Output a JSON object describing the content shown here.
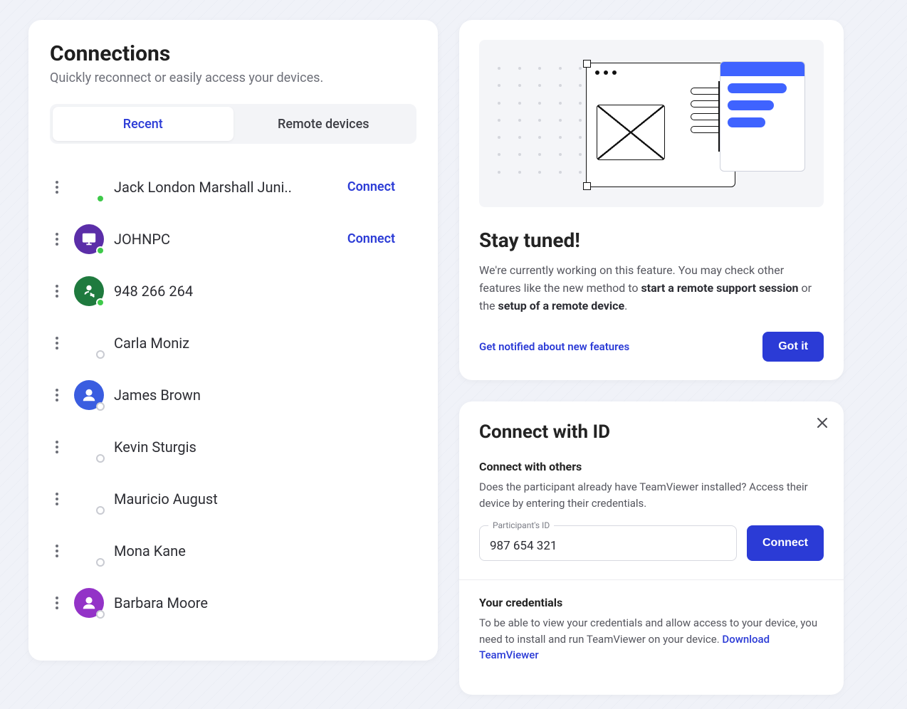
{
  "connections": {
    "title": "Connections",
    "subtitle": "Quickly reconnect or easily access your devices.",
    "tabs": {
      "recent": "Recent",
      "remote": "Remote devices"
    },
    "connect_label": "Connect",
    "items": [
      {
        "name": "Jack London Marshall Juni..",
        "avatar": "none",
        "status": "online",
        "connect": true
      },
      {
        "name": "JOHNPC",
        "avatar": "monitor",
        "color": "#5b2ea8",
        "status": "online",
        "connect": true
      },
      {
        "name": "948 266 264",
        "avatar": "swap",
        "color": "#1f7a3e",
        "status": "online",
        "connect": false
      },
      {
        "name": "Carla Moniz",
        "avatar": "none",
        "status": "offline",
        "connect": false
      },
      {
        "name": "James Brown",
        "avatar": "person",
        "color": "#3a5de0",
        "status": "offline",
        "connect": false
      },
      {
        "name": "Kevin Sturgis",
        "avatar": "none",
        "status": "offline",
        "connect": false
      },
      {
        "name": "Mauricio August",
        "avatar": "none",
        "status": "offline",
        "connect": false
      },
      {
        "name": "Mona Kane",
        "avatar": "none",
        "status": "offline",
        "connect": false
      },
      {
        "name": "Barbara Moore",
        "avatar": "person",
        "color": "#9333c7",
        "status": "offline",
        "connect": false
      }
    ]
  },
  "feature": {
    "title": "Stay tuned!",
    "text_prefix": "We're currently working on this feature. You may check other features like the new method to ",
    "bold1": "start a remote support session",
    "mid": " or the ",
    "bold2": "setup of a remote device",
    "suffix": ".",
    "notify_link": "Get notified about new features",
    "got_it": "Got it"
  },
  "connect_id": {
    "title": "Connect with ID",
    "sub1_heading": "Connect with others",
    "sub1_text": "Does the participant already have TeamViewer installed? Access their device by entering their credentials.",
    "id_label": "Participant's ID",
    "id_value": "987 654 321",
    "connect_btn": "Connect",
    "sub2_heading": "Your credentials",
    "sub2_text": "To be able to view your credentials and allow access to your device, you need to install and run TeamViewer on your device.  ",
    "download_link": "Download TeamViewer"
  }
}
